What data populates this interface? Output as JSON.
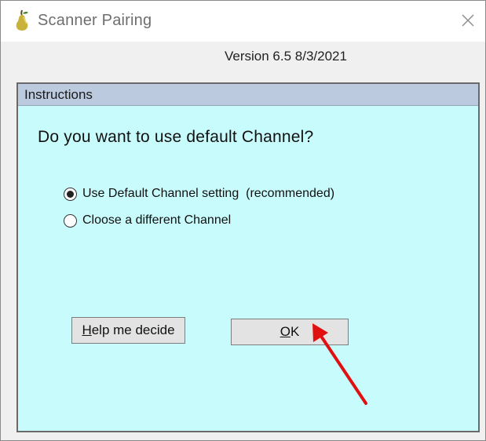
{
  "window": {
    "title": "Scanner Pairing",
    "version": "Version 6.5 8/3/2021",
    "icon": "pear-icon",
    "close_icon": "close-icon"
  },
  "panel": {
    "header": "Instructions",
    "question": "Do you want to use default Channel?",
    "options": [
      {
        "label": "Use Default Channel setting  (recommended)",
        "selected": true
      },
      {
        "label": "Cloose a different Channel",
        "selected": false
      }
    ],
    "help_button": {
      "mnemonic": "H",
      "rest": "elp me decide"
    },
    "ok_button": {
      "mnemonic": "O",
      "rest": "K"
    }
  },
  "colors": {
    "panel_bg": "#c8fbfb",
    "header_bg": "#bccadf",
    "annotation_arrow": "#e01010"
  }
}
